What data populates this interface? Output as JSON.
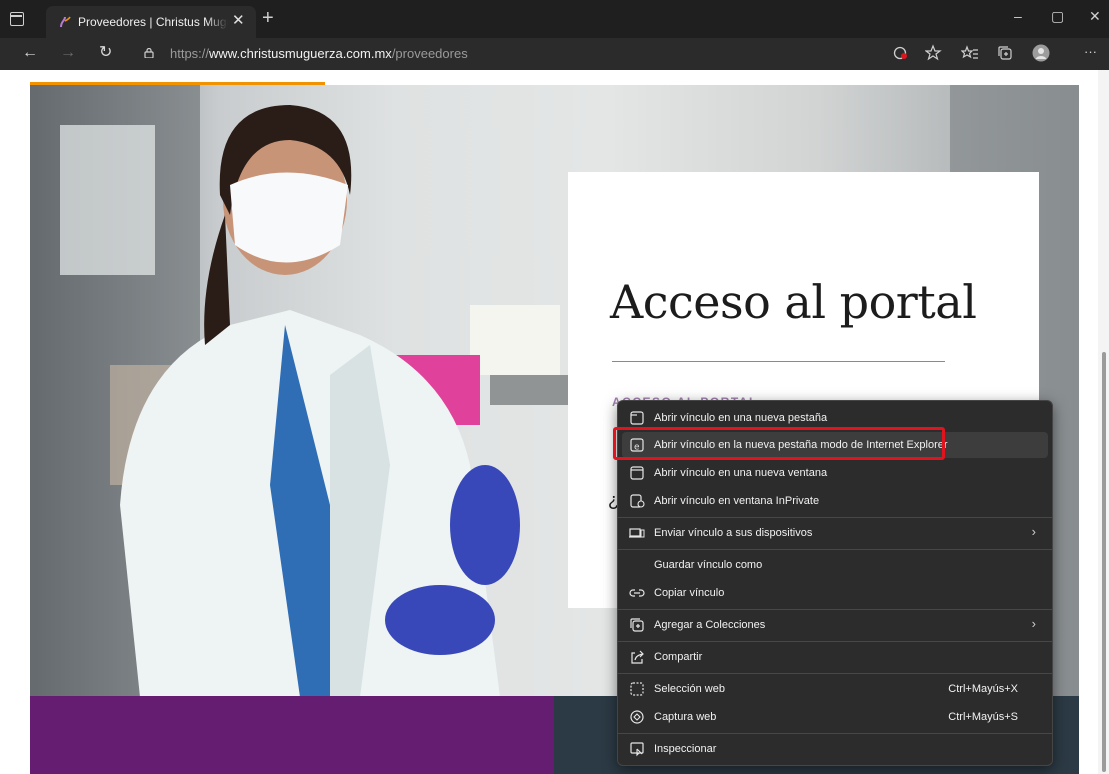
{
  "browser": {
    "tab_title": "Proveedores | Christus Muguerza",
    "tab_close": "✕",
    "new_tab": "+",
    "window_controls": {
      "minimize": "–",
      "maximize": "▢",
      "close": "✕"
    },
    "nav": {
      "back": "←",
      "forward": "→",
      "refresh": "↻",
      "more": "···"
    },
    "url_prefix": "https://",
    "url_domain": "www.christusmuguerza.com.mx",
    "url_path": "/proveedores"
  },
  "page": {
    "card_title": "Acceso al portal",
    "card_link": "ACCESO AL PORTAL",
    "card_question": "¿"
  },
  "context_menu": {
    "items": [
      {
        "label": "Abrir vínculo en una nueva pestaña",
        "icon": "new-tab-icon"
      },
      {
        "label": "Abrir vínculo en la nueva pestaña modo de Internet Explorer",
        "icon": "ie-mode-icon"
      },
      {
        "label": "Abrir vínculo en una nueva ventana",
        "icon": "new-window-icon"
      },
      {
        "label": "Abrir vínculo en ventana InPrivate",
        "icon": "inprivate-icon"
      },
      {
        "label": "Enviar vínculo a sus dispositivos",
        "icon": "devices-icon",
        "arrow": "›"
      },
      {
        "label": "Guardar vínculo como"
      },
      {
        "label": "Copiar vínculo",
        "icon": "link-icon"
      },
      {
        "label": "Agregar a Colecciones",
        "icon": "collections-icon",
        "arrow": "›"
      },
      {
        "label": "Compartir",
        "icon": "share-icon"
      },
      {
        "label": "Selección web",
        "icon": "web-select-icon",
        "shortcut": "Ctrl+Mayús+X"
      },
      {
        "label": "Captura web",
        "icon": "web-capture-icon",
        "shortcut": "Ctrl+Mayús+S"
      },
      {
        "label": "Inspeccionar",
        "icon": "inspect-icon"
      }
    ]
  },
  "colors": {
    "accent_orange": "#f39200",
    "purple": "#651d72",
    "highlight_red": "#e0141e"
  }
}
